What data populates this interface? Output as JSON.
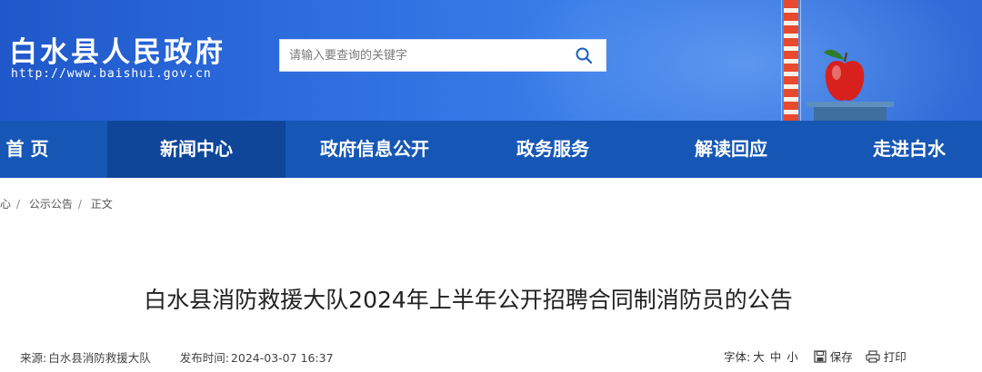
{
  "header": {
    "site_title": "白水县人民政府",
    "site_url": "http://www.baishui.gov.cn",
    "search_placeholder": "请输入要查询的关键字"
  },
  "nav": {
    "items": [
      {
        "label": "首 页"
      },
      {
        "label": "新闻中心",
        "active": true
      },
      {
        "label": "政府信息公开"
      },
      {
        "label": "政务服务"
      },
      {
        "label": "解读回应"
      },
      {
        "label": "走进白水"
      }
    ]
  },
  "breadcrumb": {
    "items": [
      "心",
      "公示公告",
      "正文"
    ],
    "separator": "/"
  },
  "article": {
    "title": "白水县消防救援大队2024年上半年公开招聘合同制消防员的公告",
    "source_label": "来源:",
    "source": "白水县消防救援大队",
    "date_label": "发布时间:",
    "date": "2024-03-07 16:37"
  },
  "tools": {
    "font_label": "字体:",
    "sizes": [
      "大",
      "中",
      "小"
    ],
    "save_label": "保存",
    "print_label": "打印"
  },
  "colors": {
    "banner": "#2f6fe0",
    "nav": "#1657b6",
    "nav_active": "#0f4699",
    "search_icon": "#1b5fc4"
  }
}
